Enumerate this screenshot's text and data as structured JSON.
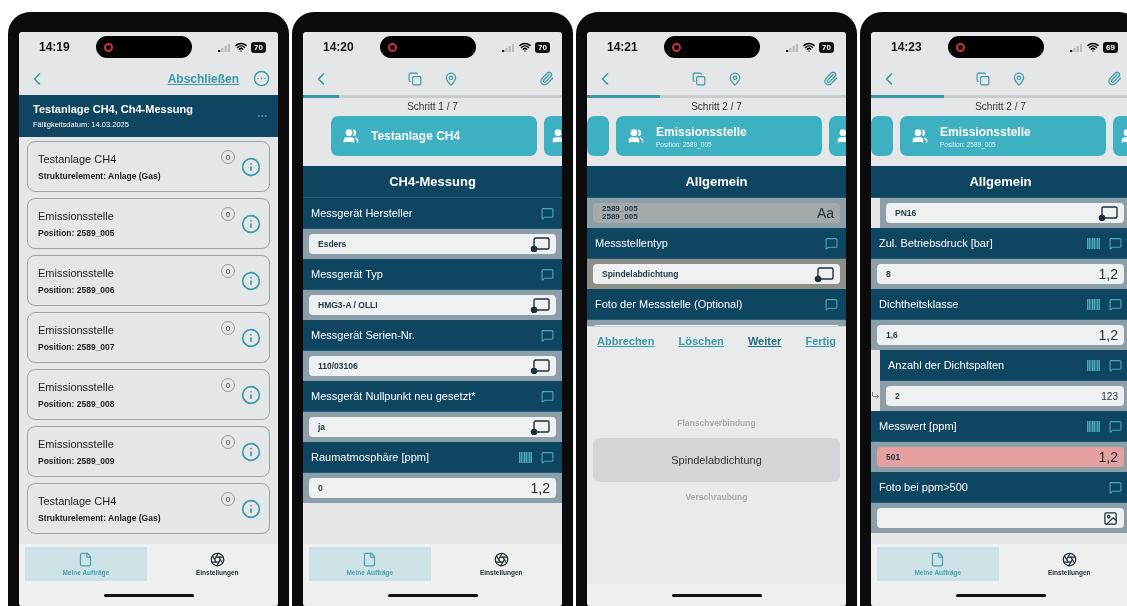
{
  "phones": [
    {
      "kind": "list",
      "status": {
        "time": "14:19",
        "battery": "70"
      },
      "action": "Abschließen",
      "header": {
        "title": "Testanlage CH4, Ch4-Messung",
        "subtitle": "Fälligkeitsdatum: 14.03.2025"
      },
      "items": [
        {
          "title": "Testanlage CH4",
          "subtitle": "Strukturelement: Anlage (Gas)",
          "count": "0"
        },
        {
          "title": "Emissionsstelle",
          "subtitle": "Position: 2589_005",
          "count": "0"
        },
        {
          "title": "Emissionsstelle",
          "subtitle": "Position: 2589_006",
          "count": "0"
        },
        {
          "title": "Emissionsstelle",
          "subtitle": "Position: 2589_007",
          "count": "0"
        },
        {
          "title": "Emissionsstelle",
          "subtitle": "Position: 2589_008",
          "count": "0"
        },
        {
          "title": "Emissionsstelle",
          "subtitle": "Position: 2589_009",
          "count": "0"
        },
        {
          "title": "Testanlage CH4",
          "subtitle": "Strukturelement: Anlage (Gas)",
          "count": "0"
        }
      ],
      "tabs": [
        {
          "label": "Meine Aufträge",
          "selected": true
        },
        {
          "label": "Einstellungen",
          "selected": false
        }
      ]
    },
    {
      "kind": "form",
      "status": {
        "time": "14:20",
        "battery": "70"
      },
      "progress": {
        "level": 0.14
      },
      "step": "Schritt 1 / 7",
      "cards": [
        {
          "kind": "main",
          "title": "Testanlage CH4"
        },
        {
          "kind": "peek"
        }
      ],
      "section": "CH4-Messung",
      "fields": [
        {
          "label": "Messgerät Hersteller",
          "value": "Esders",
          "kind": "choice",
          "barcode": false,
          "indented": false,
          "linked": false,
          "focused": false,
          "alert": false,
          "disabled": false
        },
        {
          "label": "Messgerät Typ",
          "value": "HMG3-A / OLLI",
          "kind": "choice",
          "barcode": false,
          "indented": false,
          "linked": false,
          "focused": false,
          "alert": false,
          "disabled": false
        },
        {
          "label": "Messgerät Serien-Nr.",
          "value": "110/03106",
          "kind": "choice",
          "barcode": false,
          "indented": false,
          "linked": false,
          "focused": false,
          "alert": false,
          "disabled": false
        },
        {
          "label": "Messgerät Nullpunkt neu gesetzt*",
          "value": "ja",
          "kind": "choice",
          "barcode": false,
          "indented": false,
          "linked": false,
          "focused": false,
          "alert": false,
          "disabled": false
        },
        {
          "label": "Raumatmosphäre [ppm]",
          "value": "0",
          "kind": "number",
          "hint": "1,2",
          "barcode": true,
          "indented": false,
          "linked": false,
          "focused": false,
          "alert": false,
          "disabled": false
        }
      ],
      "tabs": [
        {
          "label": "Meine Aufträge",
          "selected": true
        },
        {
          "label": "Einstellungen",
          "selected": false
        }
      ]
    },
    {
      "kind": "picker",
      "status": {
        "time": "14:21",
        "battery": "70"
      },
      "progress": {
        "level": 0.28
      },
      "step": "Schritt 2 / 7",
      "cards": [
        {
          "kind": "peek"
        },
        {
          "kind": "main",
          "title": "Emissionsstelle",
          "subtitle": "Position: 2589_005"
        },
        {
          "kind": "peek"
        }
      ],
      "section": "Allgemein",
      "fields": [
        {
          "value": "2589_005\n2589_005",
          "kind": "text",
          "hint": "Aa",
          "indented": false,
          "linked": false,
          "focused": false,
          "alert": false,
          "disabled": true
        },
        {
          "label": "Messstellentyp",
          "value": "Spindelabdichtung",
          "kind": "choice",
          "barcode": false,
          "indented": false,
          "linked": false,
          "focused": true,
          "alert": false,
          "disabled": false
        },
        {
          "label": "Foto der Messstelle (Optional)",
          "kind": "photo",
          "barcode": false,
          "indented": false,
          "linked": false,
          "focused": false,
          "alert": false,
          "disabled": false
        }
      ],
      "picker": {
        "actions": [
          "Abbrechen",
          "Löschen",
          "Weiter",
          "Fertig"
        ],
        "options": [
          {
            "label": "Flanschverbindung",
            "selected": false
          },
          {
            "label": "Spindelabdichtung",
            "selected": true
          },
          {
            "label": "Verschraubung",
            "selected": false
          }
        ]
      }
    },
    {
      "kind": "form",
      "status": {
        "time": "14:23",
        "battery": "69"
      },
      "progress": {
        "level": 0.28
      },
      "step": "Schritt 2 / 7",
      "cards": [
        {
          "kind": "peek"
        },
        {
          "kind": "main",
          "title": "Emissionsstelle",
          "subtitle": "Position: 2589_005"
        },
        {
          "kind": "peek"
        }
      ],
      "section": "Allgemein",
      "fields": [
        {
          "value": "PN16",
          "kind": "choice",
          "indented": true,
          "linked": false,
          "focused": false,
          "alert": false,
          "disabled": false
        },
        {
          "label": "Zul. Betriebsdruck [bar]",
          "value": "8",
          "kind": "number",
          "hint": "1,2",
          "barcode": true,
          "indented": false,
          "linked": false,
          "focused": false,
          "alert": false,
          "disabled": false
        },
        {
          "label": "Dichtheitsklasse",
          "value": "1,6",
          "kind": "number",
          "hint": "1,2",
          "barcode": true,
          "indented": false,
          "linked": false,
          "focused": false,
          "alert": false,
          "disabled": false
        },
        {
          "label": "Anzahl der Dichtspalten",
          "value": "2",
          "kind": "integer",
          "hint": "123",
          "barcode": true,
          "indented": true,
          "linked": true,
          "focused": false,
          "alert": false,
          "disabled": false
        },
        {
          "label": "Messwert [ppm]",
          "value": "501",
          "kind": "number",
          "hint": "1,2",
          "barcode": true,
          "indented": false,
          "linked": false,
          "focused": false,
          "alert": true,
          "disabled": false
        },
        {
          "label": "Foto bei ppm>500",
          "kind": "photo",
          "barcode": false,
          "indented": false,
          "linked": false,
          "focused": false,
          "alert": false,
          "disabled": false
        }
      ],
      "tabs": [
        {
          "label": "Meine Aufträge",
          "selected": true
        },
        {
          "label": "Einstellungen",
          "selected": false
        }
      ]
    }
  ]
}
